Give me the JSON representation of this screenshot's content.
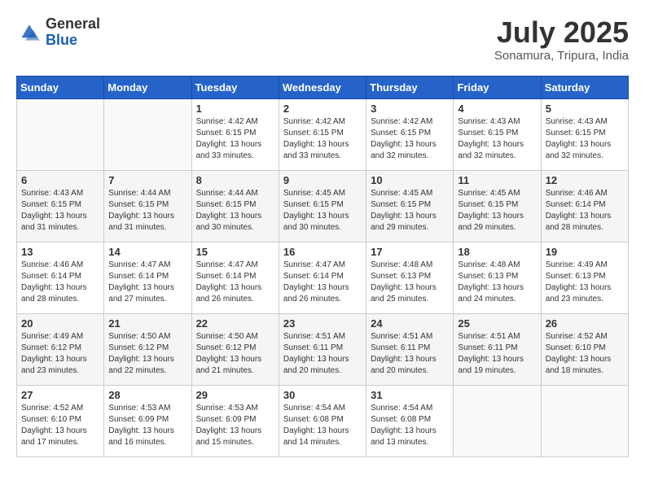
{
  "header": {
    "logo_general": "General",
    "logo_blue": "Blue",
    "month_title": "July 2025",
    "location": "Sonamura, Tripura, India"
  },
  "weekdays": [
    "Sunday",
    "Monday",
    "Tuesday",
    "Wednesday",
    "Thursday",
    "Friday",
    "Saturday"
  ],
  "weeks": [
    [
      {
        "day": "",
        "info": ""
      },
      {
        "day": "",
        "info": ""
      },
      {
        "day": "1",
        "info": "Sunrise: 4:42 AM\nSunset: 6:15 PM\nDaylight: 13 hours and 33 minutes."
      },
      {
        "day": "2",
        "info": "Sunrise: 4:42 AM\nSunset: 6:15 PM\nDaylight: 13 hours and 33 minutes."
      },
      {
        "day": "3",
        "info": "Sunrise: 4:42 AM\nSunset: 6:15 PM\nDaylight: 13 hours and 32 minutes."
      },
      {
        "day": "4",
        "info": "Sunrise: 4:43 AM\nSunset: 6:15 PM\nDaylight: 13 hours and 32 minutes."
      },
      {
        "day": "5",
        "info": "Sunrise: 4:43 AM\nSunset: 6:15 PM\nDaylight: 13 hours and 32 minutes."
      }
    ],
    [
      {
        "day": "6",
        "info": "Sunrise: 4:43 AM\nSunset: 6:15 PM\nDaylight: 13 hours and 31 minutes."
      },
      {
        "day": "7",
        "info": "Sunrise: 4:44 AM\nSunset: 6:15 PM\nDaylight: 13 hours and 31 minutes."
      },
      {
        "day": "8",
        "info": "Sunrise: 4:44 AM\nSunset: 6:15 PM\nDaylight: 13 hours and 30 minutes."
      },
      {
        "day": "9",
        "info": "Sunrise: 4:45 AM\nSunset: 6:15 PM\nDaylight: 13 hours and 30 minutes."
      },
      {
        "day": "10",
        "info": "Sunrise: 4:45 AM\nSunset: 6:15 PM\nDaylight: 13 hours and 29 minutes."
      },
      {
        "day": "11",
        "info": "Sunrise: 4:45 AM\nSunset: 6:15 PM\nDaylight: 13 hours and 29 minutes."
      },
      {
        "day": "12",
        "info": "Sunrise: 4:46 AM\nSunset: 6:14 PM\nDaylight: 13 hours and 28 minutes."
      }
    ],
    [
      {
        "day": "13",
        "info": "Sunrise: 4:46 AM\nSunset: 6:14 PM\nDaylight: 13 hours and 28 minutes."
      },
      {
        "day": "14",
        "info": "Sunrise: 4:47 AM\nSunset: 6:14 PM\nDaylight: 13 hours and 27 minutes."
      },
      {
        "day": "15",
        "info": "Sunrise: 4:47 AM\nSunset: 6:14 PM\nDaylight: 13 hours and 26 minutes."
      },
      {
        "day": "16",
        "info": "Sunrise: 4:47 AM\nSunset: 6:14 PM\nDaylight: 13 hours and 26 minutes."
      },
      {
        "day": "17",
        "info": "Sunrise: 4:48 AM\nSunset: 6:13 PM\nDaylight: 13 hours and 25 minutes."
      },
      {
        "day": "18",
        "info": "Sunrise: 4:48 AM\nSunset: 6:13 PM\nDaylight: 13 hours and 24 minutes."
      },
      {
        "day": "19",
        "info": "Sunrise: 4:49 AM\nSunset: 6:13 PM\nDaylight: 13 hours and 23 minutes."
      }
    ],
    [
      {
        "day": "20",
        "info": "Sunrise: 4:49 AM\nSunset: 6:12 PM\nDaylight: 13 hours and 23 minutes."
      },
      {
        "day": "21",
        "info": "Sunrise: 4:50 AM\nSunset: 6:12 PM\nDaylight: 13 hours and 22 minutes."
      },
      {
        "day": "22",
        "info": "Sunrise: 4:50 AM\nSunset: 6:12 PM\nDaylight: 13 hours and 21 minutes."
      },
      {
        "day": "23",
        "info": "Sunrise: 4:51 AM\nSunset: 6:11 PM\nDaylight: 13 hours and 20 minutes."
      },
      {
        "day": "24",
        "info": "Sunrise: 4:51 AM\nSunset: 6:11 PM\nDaylight: 13 hours and 20 minutes."
      },
      {
        "day": "25",
        "info": "Sunrise: 4:51 AM\nSunset: 6:11 PM\nDaylight: 13 hours and 19 minutes."
      },
      {
        "day": "26",
        "info": "Sunrise: 4:52 AM\nSunset: 6:10 PM\nDaylight: 13 hours and 18 minutes."
      }
    ],
    [
      {
        "day": "27",
        "info": "Sunrise: 4:52 AM\nSunset: 6:10 PM\nDaylight: 13 hours and 17 minutes."
      },
      {
        "day": "28",
        "info": "Sunrise: 4:53 AM\nSunset: 6:09 PM\nDaylight: 13 hours and 16 minutes."
      },
      {
        "day": "29",
        "info": "Sunrise: 4:53 AM\nSunset: 6:09 PM\nDaylight: 13 hours and 15 minutes."
      },
      {
        "day": "30",
        "info": "Sunrise: 4:54 AM\nSunset: 6:08 PM\nDaylight: 13 hours and 14 minutes."
      },
      {
        "day": "31",
        "info": "Sunrise: 4:54 AM\nSunset: 6:08 PM\nDaylight: 13 hours and 13 minutes."
      },
      {
        "day": "",
        "info": ""
      },
      {
        "day": "",
        "info": ""
      }
    ]
  ]
}
